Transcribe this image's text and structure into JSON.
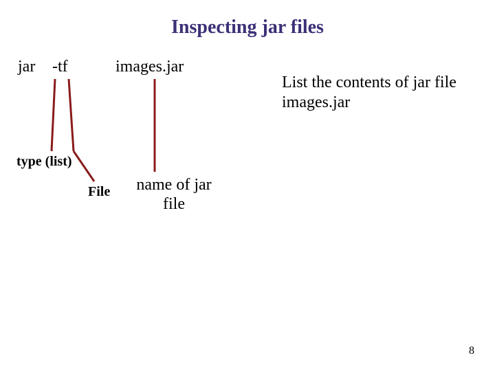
{
  "title": "Inspecting jar files",
  "command": {
    "jar": "jar",
    "flags": "-tf",
    "filename": "images.jar"
  },
  "description": "List the contents of jar file images.jar",
  "labels": {
    "type": "type (list)",
    "file": "File",
    "name": "name of jar file"
  },
  "page_number": "8"
}
